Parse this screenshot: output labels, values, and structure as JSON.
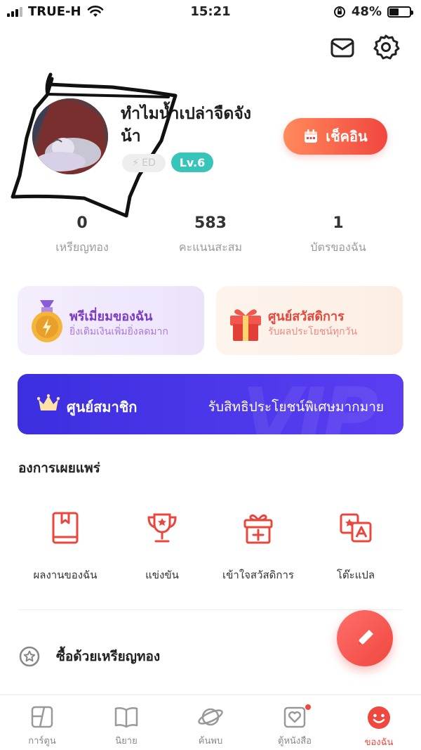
{
  "status_bar": {
    "carrier": "TRUE-H",
    "time": "15:21",
    "battery": "48%",
    "battery_level": 0.48
  },
  "header": {
    "mail_icon": "mail-icon",
    "settings_icon": "gear-icon"
  },
  "profile": {
    "username": "ทำไมน้ำเปล่าจืดจังน้า",
    "badge_grey": "ED",
    "level": "Lv.6",
    "checkin_label": "เช็คอิน"
  },
  "stats": [
    {
      "value": "0",
      "label": "เหรียญทอง"
    },
    {
      "value": "583",
      "label": "คะแนนสะสม"
    },
    {
      "value": "1",
      "label": "บัตรของฉัน"
    }
  ],
  "cards": {
    "premium": {
      "title": "พรีเมี่ยมของฉัน",
      "subtitle": "ยิ่งเติมเงินเพิ่มยิ่งลดมาก"
    },
    "welfare": {
      "title": "ศูนย์สวัสดิการ",
      "subtitle": "รับผลประโยชน์ทุกวัน"
    }
  },
  "vip": {
    "title": "ศูนย์สมาชิก",
    "promo": "รับสิทธิประโยชน์พิเศษมากมาย",
    "watermark": "VIP"
  },
  "section": {
    "title": "องการเผยแพร่",
    "tools": [
      {
        "label": "ผลงานของฉัน",
        "icon": "book-icon"
      },
      {
        "label": "แข่งขัน",
        "icon": "trophy-icon"
      },
      {
        "label": "เข้าใจสวัสดิการ",
        "icon": "gift-icon"
      },
      {
        "label": "โต๊ะแปล",
        "icon": "translate-icon"
      }
    ]
  },
  "buy_with_gold": "ซื้อด้วยเหรียญทอง",
  "nav": [
    {
      "label": "การ์ตูน",
      "icon": "comic-icon"
    },
    {
      "label": "นิยาย",
      "icon": "open-book-icon"
    },
    {
      "label": "ค้นพบ",
      "icon": "planet-icon"
    },
    {
      "label": "ตู้หนังสือ",
      "icon": "bookshelf-heart-icon"
    },
    {
      "label": "ของฉัน",
      "icon": "smiley-icon"
    }
  ],
  "colors": {
    "accent": "#f0473f",
    "level": "#37c5b9",
    "vip": "#4a36ea",
    "premium": "#7b3cc7"
  }
}
